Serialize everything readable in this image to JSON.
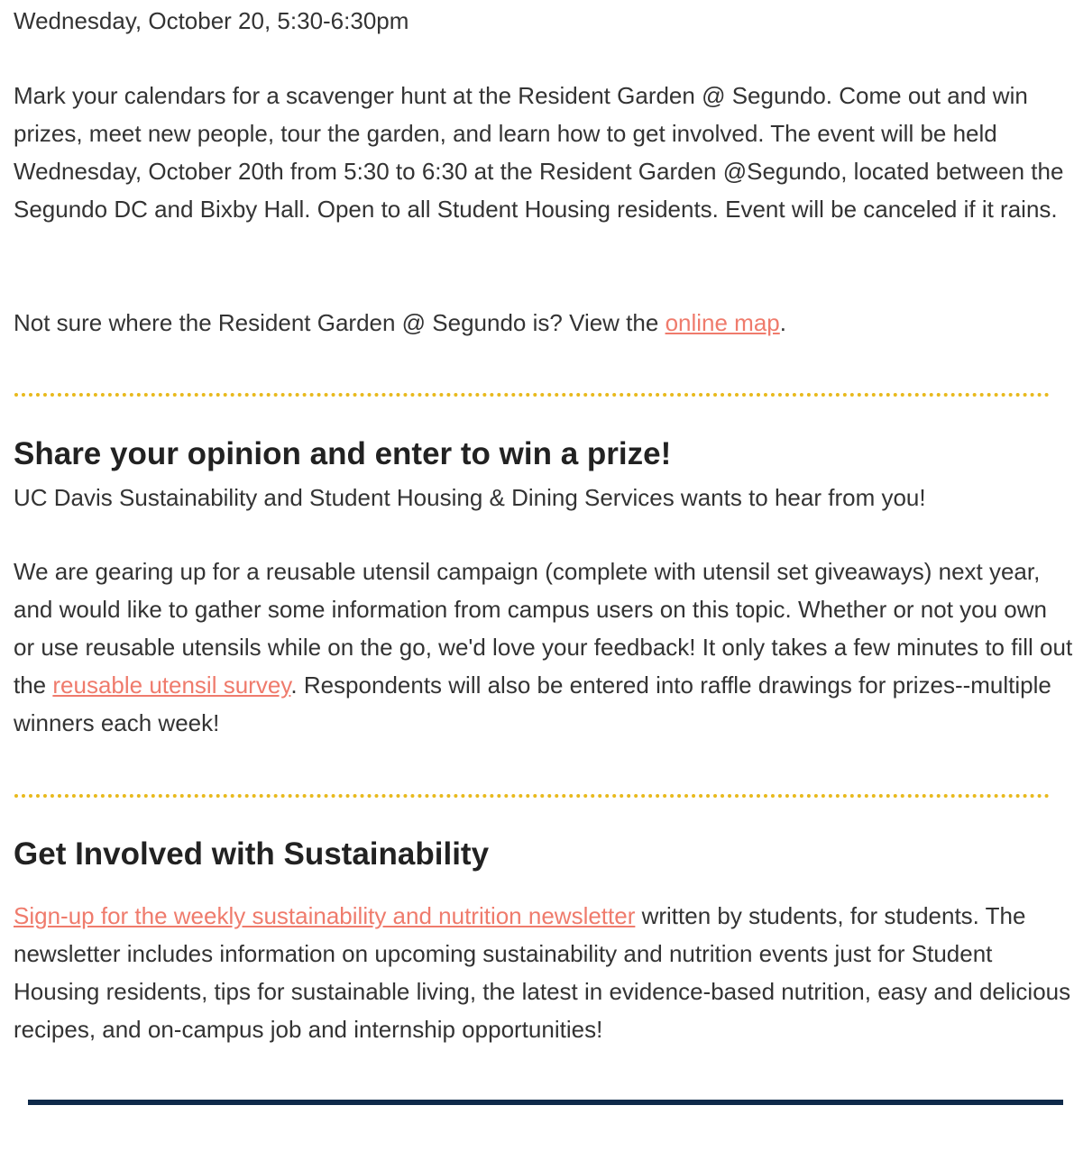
{
  "event": {
    "date_line": "Wednesday, October 20, 5:30-6:30pm",
    "description": "Mark your calendars for a scavenger hunt at the Resident Garden @ Segundo. Come out and win prizes, meet new people, tour the garden, and learn how to get involved. The event will be held Wednesday, October 20th from 5:30 to 6:30 at the Resident Garden @Segundo, located between the Segundo DC and Bixby Hall. Open to all Student Housing residents. Event will be canceled if it rains.",
    "map_prefix": "Not sure where the Resident Garden @ Segundo is? View the ",
    "map_link": "online map",
    "map_suffix": "."
  },
  "survey": {
    "heading": "Share your opinion and enter to win a prize!",
    "intro": "UC Davis Sustainability and Student Housing & Dining Services wants to hear from you!",
    "body_prefix": "We are gearing up for a reusable utensil campaign (complete with utensil set giveaways) next year, and would like to gather some information from campus users on this topic. Whether or not you own or use reusable utensils while on the go, we'd love your feedback! It only takes a few minutes to fill out the ",
    "survey_link": "reusable utensil survey",
    "body_suffix": ". Respondents will also be entered into raffle drawings for prizes--multiple winners each week!"
  },
  "involved": {
    "heading": "Get Involved with Sustainability",
    "signup_link": "Sign-up for the weekly sustainability and nutrition newsletter",
    "body": " written by students, for students. The newsletter includes information on upcoming sustainability and nutrition events just for Student Housing residents, tips for sustainable living, the latest in evidence-based nutrition, easy and delicious recipes, and on-campus job and internship opportunities!"
  },
  "colors": {
    "link": "#ef7b6c",
    "divider": "#e8b91c",
    "footer_bar": "#0f2a4a",
    "text": "#333333"
  }
}
